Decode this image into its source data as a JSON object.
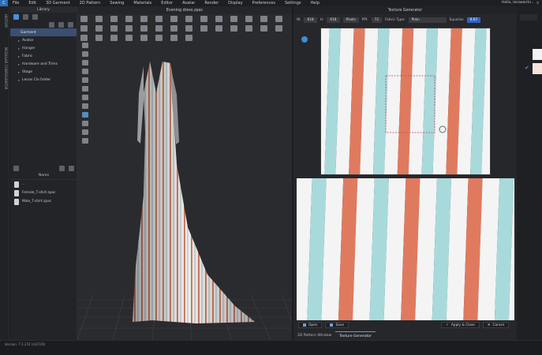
{
  "menubar": {
    "logo": "C",
    "items": [
      "File",
      "Edit",
      "3D Garment",
      "2D Pattern",
      "Sewing",
      "Materials",
      "Editor",
      "Avatar",
      "Render",
      "Display",
      "Preferences",
      "Settings",
      "Help"
    ],
    "user": "Hello, lenaeerrin"
  },
  "left_rail": {
    "history": "HISTORY",
    "modular": "MODULAR CONFIGURATOR"
  },
  "library": {
    "title": "Library",
    "items": [
      {
        "label": "Garment",
        "selected": true
      },
      {
        "label": "Avatar",
        "selected": false
      },
      {
        "label": "Hanger",
        "selected": false
      },
      {
        "label": "Fabric",
        "selected": false
      },
      {
        "label": "Hardware and Trims",
        "selected": false
      },
      {
        "label": "Stage",
        "selected": false
      },
      {
        "label": "Lenas Clo folder",
        "selected": false
      }
    ],
    "browser": {
      "column": "Name",
      "files": [
        "..",
        "Female_T-shirt.zpac",
        "Male_T-shirt.zpac"
      ]
    }
  },
  "viewport": {
    "title": "Evening dress.zpac"
  },
  "texture_generator": {
    "title": "Texture Generator",
    "w_label": "W:",
    "w_value": "618",
    "h_label": "H:",
    "h_value": "618",
    "unit": "Pixels",
    "ppi_label": "PPI:",
    "ppi_value": "72",
    "fabric_type_label": "Fabric Type:",
    "fabric_type_value": "Plain",
    "equalize_label": "Equalize",
    "equalize_value": "0.67",
    "open_label": "Open",
    "save_label": "Save",
    "apply_label": "Apply & Close",
    "cancel_label": "Cancel",
    "stripe_colors": [
      "#e07a5f",
      "#f4f4f4",
      "#a8dadc"
    ]
  },
  "tabs": [
    "2D Pattern Window",
    "Texture Generator"
  ],
  "status": {
    "version": "Version: 7.1.274 (r42729)"
  }
}
